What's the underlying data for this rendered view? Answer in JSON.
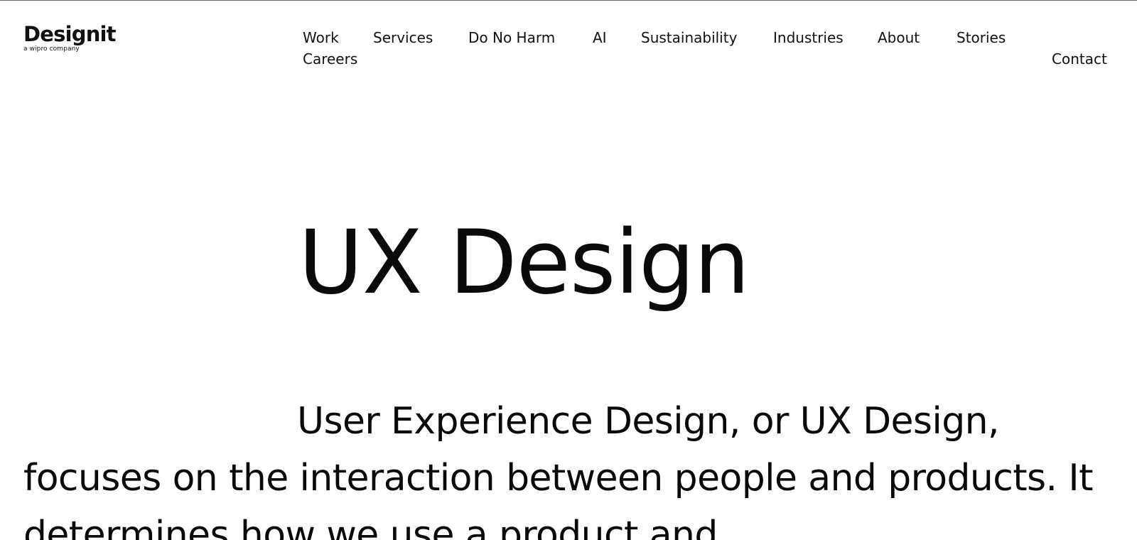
{
  "logo": {
    "wordmark": "Designit",
    "tagline": "a wipro company"
  },
  "nav": {
    "work": "Work",
    "services": "Services",
    "do_no_harm": "Do No Harm",
    "ai": "AI",
    "sustainability": "Sustainability",
    "industries": "Industries",
    "about": "About",
    "stories": "Stories",
    "careers": "Careers",
    "contact": "Contact"
  },
  "hero": {
    "title": "UX Design",
    "intro": "User Experience Design, or UX Design, focuses on the interaction between people and products. It determines how we use a product and"
  }
}
